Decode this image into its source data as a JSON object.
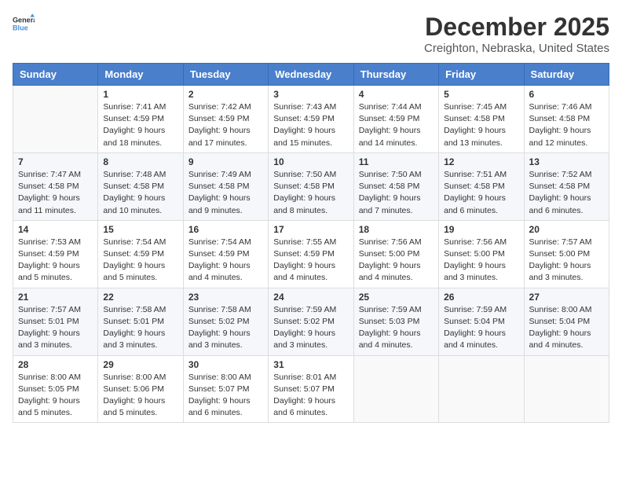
{
  "logo": {
    "general": "General",
    "blue": "Blue"
  },
  "title": "December 2025",
  "subtitle": "Creighton, Nebraska, United States",
  "headers": [
    "Sunday",
    "Monday",
    "Tuesday",
    "Wednesday",
    "Thursday",
    "Friday",
    "Saturday"
  ],
  "weeks": [
    [
      {
        "day": "",
        "info": ""
      },
      {
        "day": "1",
        "info": "Sunrise: 7:41 AM\nSunset: 4:59 PM\nDaylight: 9 hours\nand 18 minutes."
      },
      {
        "day": "2",
        "info": "Sunrise: 7:42 AM\nSunset: 4:59 PM\nDaylight: 9 hours\nand 17 minutes."
      },
      {
        "day": "3",
        "info": "Sunrise: 7:43 AM\nSunset: 4:59 PM\nDaylight: 9 hours\nand 15 minutes."
      },
      {
        "day": "4",
        "info": "Sunrise: 7:44 AM\nSunset: 4:59 PM\nDaylight: 9 hours\nand 14 minutes."
      },
      {
        "day": "5",
        "info": "Sunrise: 7:45 AM\nSunset: 4:58 PM\nDaylight: 9 hours\nand 13 minutes."
      },
      {
        "day": "6",
        "info": "Sunrise: 7:46 AM\nSunset: 4:58 PM\nDaylight: 9 hours\nand 12 minutes."
      }
    ],
    [
      {
        "day": "7",
        "info": "Sunrise: 7:47 AM\nSunset: 4:58 PM\nDaylight: 9 hours\nand 11 minutes."
      },
      {
        "day": "8",
        "info": "Sunrise: 7:48 AM\nSunset: 4:58 PM\nDaylight: 9 hours\nand 10 minutes."
      },
      {
        "day": "9",
        "info": "Sunrise: 7:49 AM\nSunset: 4:58 PM\nDaylight: 9 hours\nand 9 minutes."
      },
      {
        "day": "10",
        "info": "Sunrise: 7:50 AM\nSunset: 4:58 PM\nDaylight: 9 hours\nand 8 minutes."
      },
      {
        "day": "11",
        "info": "Sunrise: 7:50 AM\nSunset: 4:58 PM\nDaylight: 9 hours\nand 7 minutes."
      },
      {
        "day": "12",
        "info": "Sunrise: 7:51 AM\nSunset: 4:58 PM\nDaylight: 9 hours\nand 6 minutes."
      },
      {
        "day": "13",
        "info": "Sunrise: 7:52 AM\nSunset: 4:58 PM\nDaylight: 9 hours\nand 6 minutes."
      }
    ],
    [
      {
        "day": "14",
        "info": "Sunrise: 7:53 AM\nSunset: 4:59 PM\nDaylight: 9 hours\nand 5 minutes."
      },
      {
        "day": "15",
        "info": "Sunrise: 7:54 AM\nSunset: 4:59 PM\nDaylight: 9 hours\nand 5 minutes."
      },
      {
        "day": "16",
        "info": "Sunrise: 7:54 AM\nSunset: 4:59 PM\nDaylight: 9 hours\nand 4 minutes."
      },
      {
        "day": "17",
        "info": "Sunrise: 7:55 AM\nSunset: 4:59 PM\nDaylight: 9 hours\nand 4 minutes."
      },
      {
        "day": "18",
        "info": "Sunrise: 7:56 AM\nSunset: 5:00 PM\nDaylight: 9 hours\nand 4 minutes."
      },
      {
        "day": "19",
        "info": "Sunrise: 7:56 AM\nSunset: 5:00 PM\nDaylight: 9 hours\nand 3 minutes."
      },
      {
        "day": "20",
        "info": "Sunrise: 7:57 AM\nSunset: 5:00 PM\nDaylight: 9 hours\nand 3 minutes."
      }
    ],
    [
      {
        "day": "21",
        "info": "Sunrise: 7:57 AM\nSunset: 5:01 PM\nDaylight: 9 hours\nand 3 minutes."
      },
      {
        "day": "22",
        "info": "Sunrise: 7:58 AM\nSunset: 5:01 PM\nDaylight: 9 hours\nand 3 minutes."
      },
      {
        "day": "23",
        "info": "Sunrise: 7:58 AM\nSunset: 5:02 PM\nDaylight: 9 hours\nand 3 minutes."
      },
      {
        "day": "24",
        "info": "Sunrise: 7:59 AM\nSunset: 5:02 PM\nDaylight: 9 hours\nand 3 minutes."
      },
      {
        "day": "25",
        "info": "Sunrise: 7:59 AM\nSunset: 5:03 PM\nDaylight: 9 hours\nand 4 minutes."
      },
      {
        "day": "26",
        "info": "Sunrise: 7:59 AM\nSunset: 5:04 PM\nDaylight: 9 hours\nand 4 minutes."
      },
      {
        "day": "27",
        "info": "Sunrise: 8:00 AM\nSunset: 5:04 PM\nDaylight: 9 hours\nand 4 minutes."
      }
    ],
    [
      {
        "day": "28",
        "info": "Sunrise: 8:00 AM\nSunset: 5:05 PM\nDaylight: 9 hours\nand 5 minutes."
      },
      {
        "day": "29",
        "info": "Sunrise: 8:00 AM\nSunset: 5:06 PM\nDaylight: 9 hours\nand 5 minutes."
      },
      {
        "day": "30",
        "info": "Sunrise: 8:00 AM\nSunset: 5:07 PM\nDaylight: 9 hours\nand 6 minutes."
      },
      {
        "day": "31",
        "info": "Sunrise: 8:01 AM\nSunset: 5:07 PM\nDaylight: 9 hours\nand 6 minutes."
      },
      {
        "day": "",
        "info": ""
      },
      {
        "day": "",
        "info": ""
      },
      {
        "day": "",
        "info": ""
      }
    ]
  ]
}
